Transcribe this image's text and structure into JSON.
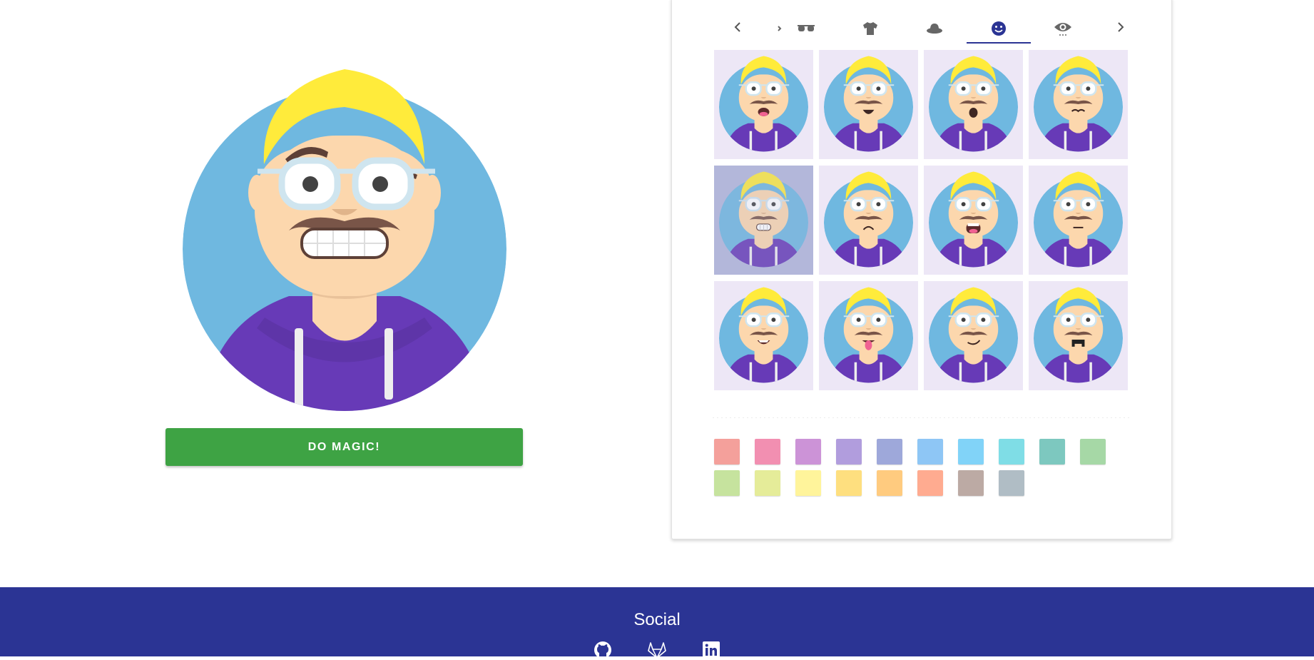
{
  "main": {
    "magic_button_label": "DO MAGIC!",
    "background_color": "#6fb8e0"
  },
  "editor": {
    "tabs": [
      {
        "name": "glasses",
        "icon": "glasses-icon"
      },
      {
        "name": "clothes",
        "icon": "shirt-icon"
      },
      {
        "name": "hat",
        "icon": "hat-icon"
      },
      {
        "name": "mouth",
        "icon": "smiley-icon",
        "active": true
      },
      {
        "name": "eyes",
        "icon": "eye-icon"
      }
    ],
    "mouth_options": [
      "open",
      "smile",
      "surprised",
      "disgusted",
      "grimace",
      "sad",
      "scream",
      "serious",
      "happy",
      "tongue",
      "smirk",
      "vomit"
    ],
    "selected_mouth": "grimace",
    "colors": [
      "#f4a09b",
      "#f28fb1",
      "#cc93d7",
      "#b19ddd",
      "#9ea8da",
      "#8ec6f5",
      "#81d3f8",
      "#7fdde6",
      "#7dc8bf",
      "#a6d8a6",
      "#c6e39e",
      "#e5ec99",
      "#fff49b",
      "#fedf7f",
      "#ffcb7f",
      "#ffab90",
      "#bcaaa4",
      "#b0bdc5"
    ]
  },
  "footer": {
    "title": "Social",
    "links": [
      "github-icon",
      "gitlab-icon",
      "linkedin-icon"
    ]
  }
}
